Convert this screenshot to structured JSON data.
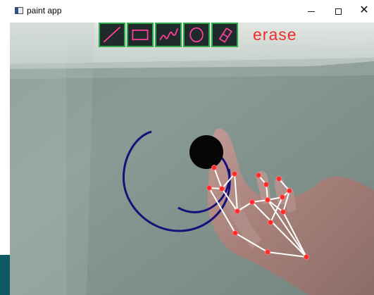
{
  "window": {
    "title": "paint app",
    "controls": {
      "minimize_icon": "minimize-icon",
      "maximize_icon": "maximize-icon",
      "close_icon": "close-icon"
    }
  },
  "toolbar": {
    "tools": [
      {
        "name": "line",
        "icon": "line-icon"
      },
      {
        "name": "rectangle",
        "icon": "rectangle-icon"
      },
      {
        "name": "freehand",
        "icon": "freehand-icon"
      },
      {
        "name": "circle",
        "icon": "circle-icon"
      },
      {
        "name": "eraser",
        "icon": "eraser-icon"
      }
    ],
    "erase_label": "erase"
  },
  "colors": {
    "title_background": "#ffffff",
    "tool_background": "#1f2b2b",
    "tool_border": "#32a84f",
    "tool_icon": "#ff3e9a",
    "erase_text": "#ef2d2d",
    "drawn_stroke": "#14127a",
    "cursor_fill": "#050505",
    "landmark_point": "#ff2a2a",
    "landmark_line": "#ffffff"
  }
}
